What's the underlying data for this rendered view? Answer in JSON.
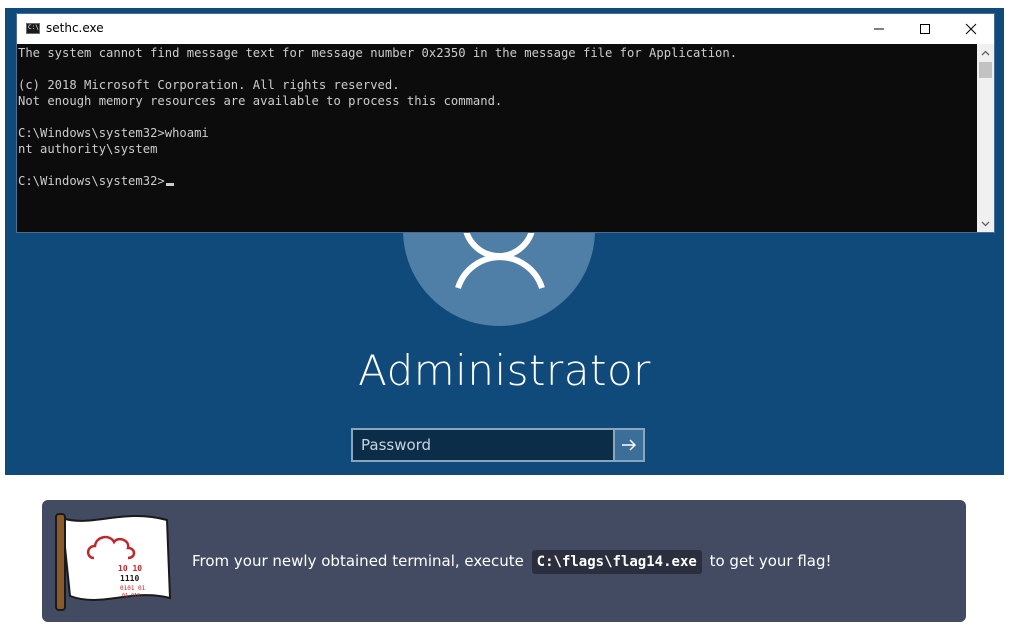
{
  "console": {
    "title": "sethc.exe",
    "lines": [
      "The system cannot find message text for message number 0x2350 in the message file for Application.",
      "",
      "(c) 2018 Microsoft Corporation. All rights reserved.",
      "Not enough memory resources are available to process this command.",
      "",
      "C:\\Windows\\system32>whoami",
      "nt authority\\system",
      ""
    ],
    "prompt": "C:\\Windows\\system32>"
  },
  "login": {
    "username": "Administrator",
    "password_placeholder": "Password"
  },
  "banner": {
    "text_before": "From your newly obtained terminal, execute",
    "command": "C:\\flags\\flag14.exe",
    "text_after": "to get your flag!",
    "flag_digits_1": "10 10",
    "flag_digits_2": "1110",
    "flag_digits_3": "0101 01",
    "flag_digits_4": "01 010",
    "accent": "#c0272d"
  },
  "colors": {
    "login_bg": "#0f4a7a",
    "console_bg": "#0c0c0c",
    "console_fg": "#cccccc",
    "banner_bg": "#434b63"
  },
  "icons": {
    "console": "cmd-icon",
    "minimize": "minimize-icon",
    "maximize": "maximize-icon",
    "close": "close-icon",
    "submit": "arrow-right-icon",
    "user": "user-icon",
    "flag": "flag-icon"
  }
}
